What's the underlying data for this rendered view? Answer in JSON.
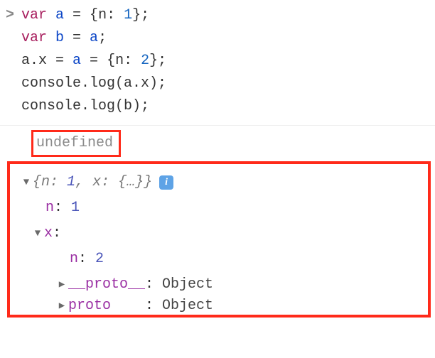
{
  "input": {
    "prompt": ">",
    "lines": {
      "l1_var": "var",
      "l1_a": " a ",
      "l1_eq": "= ",
      "l1_obj_open": "{",
      "l1_key": "n: ",
      "l1_val": "1",
      "l1_obj_close": "};",
      "l2_var": "var",
      "l2_b": " b ",
      "l2_eq": "= ",
      "l2_a": "a",
      "l2_semi": ";",
      "l3_ax": "a.x ",
      "l3_eq1": "= ",
      "l3_a": "a ",
      "l3_eq2": "= ",
      "l3_obj_open": "{",
      "l3_key": "n: ",
      "l3_val": "2",
      "l3_obj_close": "};",
      "l4": "console.log(a.x);",
      "l5": "console.log(b);"
    }
  },
  "output": {
    "undefined_text": "undefined",
    "summary": {
      "open": "{",
      "key1": "n: ",
      "val1": "1",
      "sep": ", ",
      "key2": "x: ",
      "nested": "{…}",
      "close": "}",
      "info": "i"
    },
    "tree": {
      "n_key": "n",
      "n_val": "1",
      "x_key": "x",
      "x_n_key": "n",
      "x_n_val": "2",
      "proto_key": "__proto__",
      "proto_val": "Object",
      "proto2_key": "proto",
      "proto2_val": "Object"
    }
  }
}
